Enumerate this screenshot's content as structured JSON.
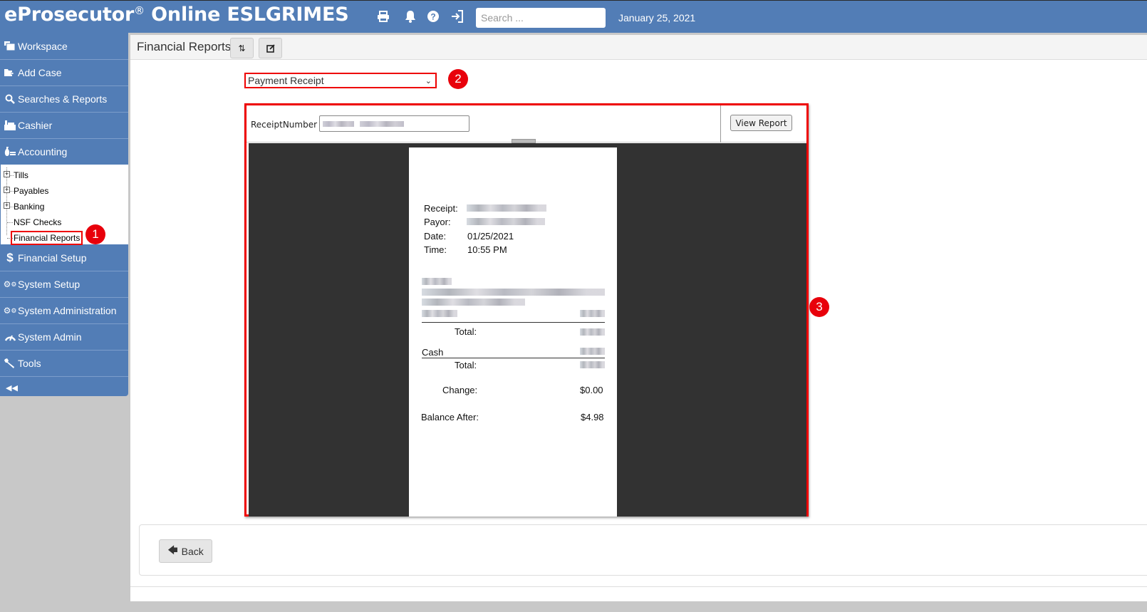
{
  "app": {
    "title_main": "eProsecutor",
    "title_mark": "®",
    "title_rest": " Online ESLGRIMES",
    "search_placeholder": "Search ...",
    "date": "January 25, 2021",
    "icons": [
      "print-icon",
      "bell-icon",
      "help-icon",
      "logout-icon"
    ]
  },
  "sidebar": {
    "items": [
      {
        "label": "Workspace",
        "icon": "workspace-icon"
      },
      {
        "label": "Add Case",
        "icon": "add-case-icon"
      },
      {
        "label": "Searches & Reports",
        "icon": "search-icon"
      },
      {
        "label": "Cashier",
        "icon": "cashier-icon"
      },
      {
        "label": "Accounting",
        "icon": "accounting-icon"
      }
    ],
    "accounting_tree": [
      {
        "label": "Tills",
        "expandable": true
      },
      {
        "label": "Payables",
        "expandable": true
      },
      {
        "label": "Banking",
        "expandable": true
      },
      {
        "label": "NSF Checks",
        "expandable": false
      },
      {
        "label": "Financial Reports",
        "expandable": false,
        "selected": true
      }
    ],
    "items_after": [
      {
        "label": "Financial Setup",
        "icon": "dollar-icon"
      },
      {
        "label": "System Setup",
        "icon": "gears-icon"
      },
      {
        "label": "System Administration",
        "icon": "gears-icon"
      },
      {
        "label": "System Admin",
        "icon": "dashboard-icon"
      },
      {
        "label": "Tools",
        "icon": "wrench-icon"
      }
    ]
  },
  "page": {
    "title": "Financial Reports",
    "report_select": {
      "selected": "Payment Receipt"
    },
    "parameters": {
      "receipt_label": "ReceiptNumber",
      "receipt_value": "[redacted]",
      "view_report_label": "View Report"
    },
    "back_label": "Back"
  },
  "receipt": {
    "labels": {
      "receipt": "Receipt:",
      "payor": "Payor:",
      "date": "Date:",
      "time": "Time:",
      "total1": "Total:",
      "cash": "Cash",
      "total2": "Total:",
      "change": "Change:",
      "balance_after": "Balance After:"
    },
    "values": {
      "receipt": "[redacted]",
      "payor": "[redacted]",
      "date": "01/25/2021",
      "time": "10:55 PM",
      "change": "$0.00",
      "balance_after": "$4.98"
    }
  },
  "annotations": [
    "1",
    "2",
    "3"
  ],
  "colors": {
    "brand_blue": "#527db6",
    "annotation_red": "#e8000b",
    "viewer_bg": "#323232"
  }
}
